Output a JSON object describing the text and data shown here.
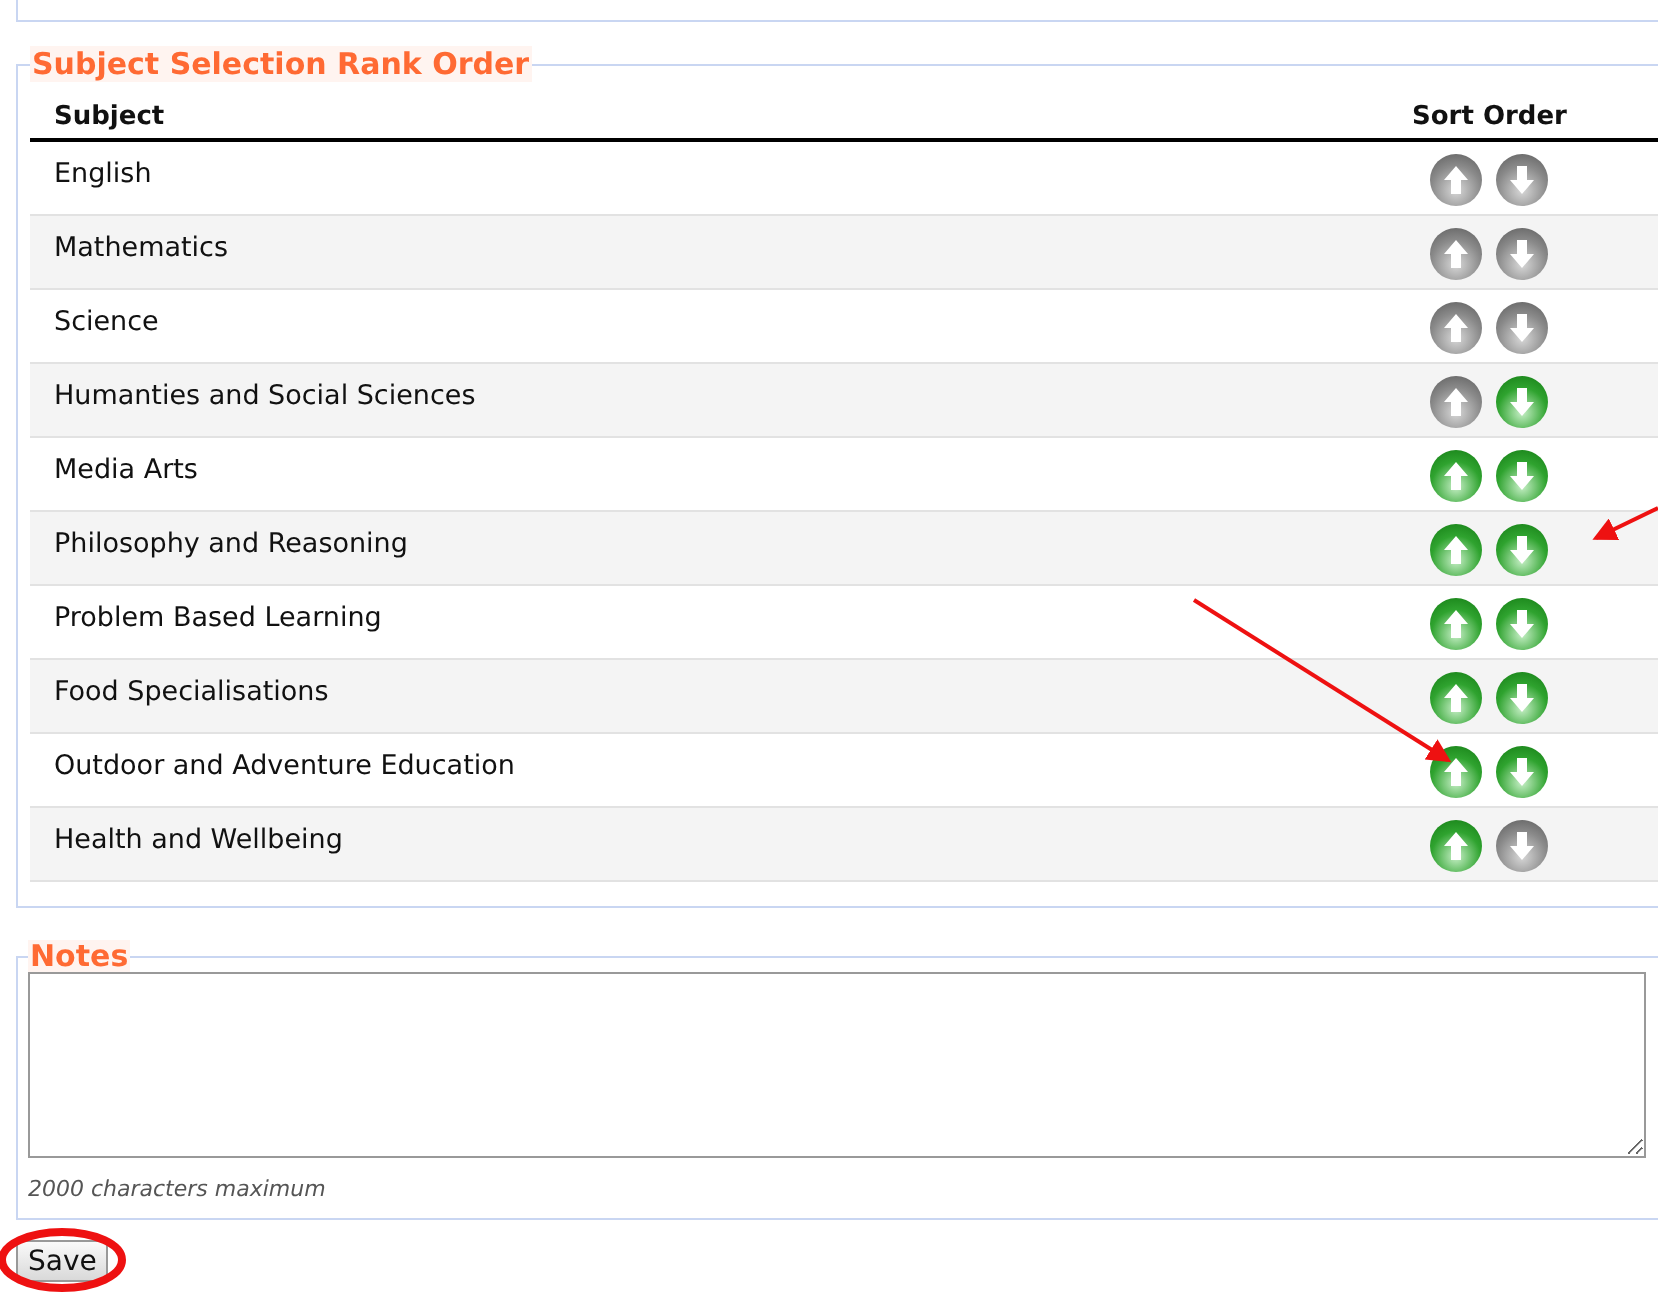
{
  "rank_section": {
    "legend": "Subject Selection Rank Order",
    "columns": [
      "Subject",
      "Sort Order"
    ],
    "rows": [
      {
        "subject": "English",
        "up_disabled": true,
        "down_disabled": true
      },
      {
        "subject": "Mathematics",
        "up_disabled": true,
        "down_disabled": true
      },
      {
        "subject": "Science",
        "up_disabled": true,
        "down_disabled": true
      },
      {
        "subject": "Humanties and Social Sciences",
        "up_disabled": true,
        "down_disabled": false
      },
      {
        "subject": "Media Arts",
        "up_disabled": false,
        "down_disabled": false
      },
      {
        "subject": "Philosophy and Reasoning",
        "up_disabled": false,
        "down_disabled": false
      },
      {
        "subject": "Problem Based Learning",
        "up_disabled": false,
        "down_disabled": false
      },
      {
        "subject": "Food Specialisations",
        "up_disabled": false,
        "down_disabled": false
      },
      {
        "subject": "Outdoor and Adventure Education",
        "up_disabled": false,
        "down_disabled": false
      },
      {
        "subject": "Health and Wellbeing",
        "up_disabled": false,
        "down_disabled": true
      }
    ]
  },
  "notes_section": {
    "legend": "Notes",
    "hint": "2000 characters maximum"
  },
  "save_button": "Save"
}
